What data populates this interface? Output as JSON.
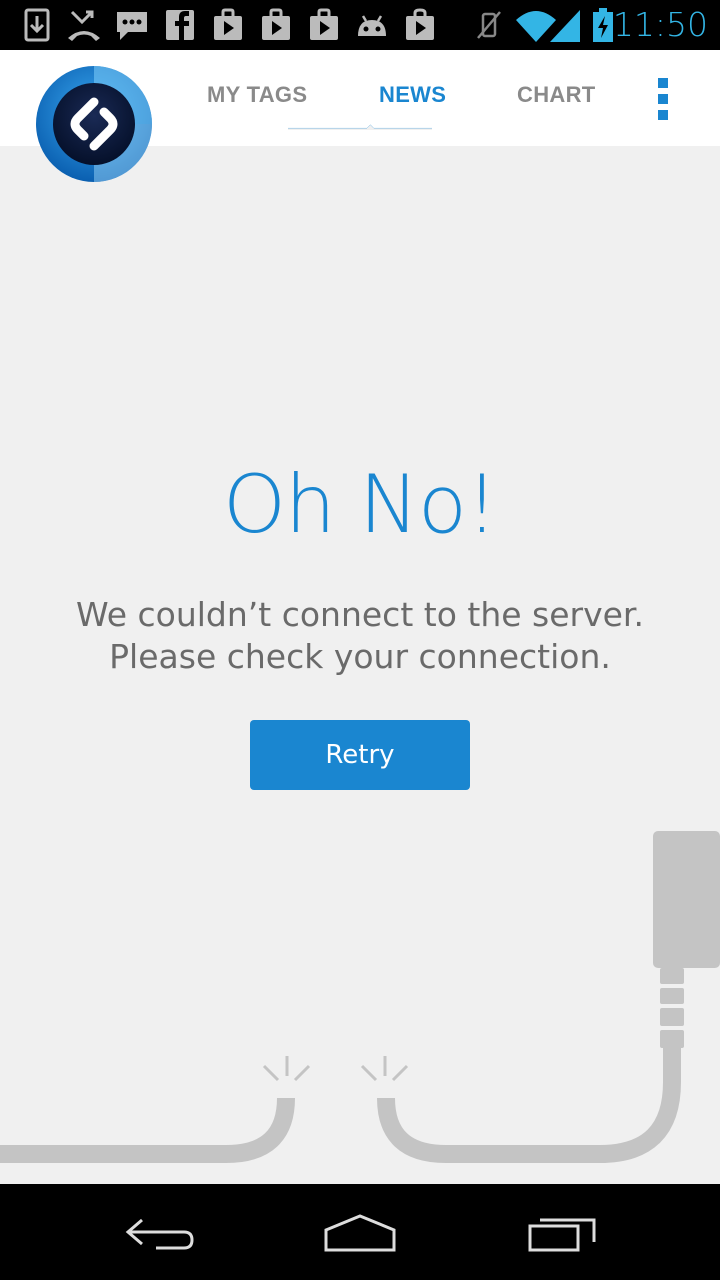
{
  "status_bar": {
    "time": "11:50",
    "notification_icons": [
      "download-icon",
      "missed-call-icon",
      "message-icon",
      "facebook-icon",
      "play-store-icon",
      "play-store-icon",
      "play-store-icon",
      "android-icon",
      "shopping-bag-icon"
    ],
    "system_icons": [
      "no-vibrate-icon",
      "wifi-icon",
      "signal-icon",
      "battery-charging-icon"
    ]
  },
  "app_bar": {
    "tabs": [
      {
        "label": "MY TAGS",
        "active": false
      },
      {
        "label": "NEWS",
        "active": true
      },
      {
        "label": "CHART",
        "active": false
      }
    ],
    "logo_icon": "shazam-logo-icon",
    "menu_icon": "overflow-menu-icon"
  },
  "error": {
    "title": "Oh No!",
    "line1": "We couldn’t connect to the server.",
    "line2": "Please check your connection.",
    "retry_label": "Retry"
  },
  "nav_bar": {
    "buttons": [
      "back-icon",
      "home-icon",
      "recent-apps-icon"
    ]
  },
  "colors": {
    "accent": "#1a86d0",
    "status_time": "#33b5e5",
    "background": "#f0f0f0",
    "cable": "#c4c4c4"
  }
}
